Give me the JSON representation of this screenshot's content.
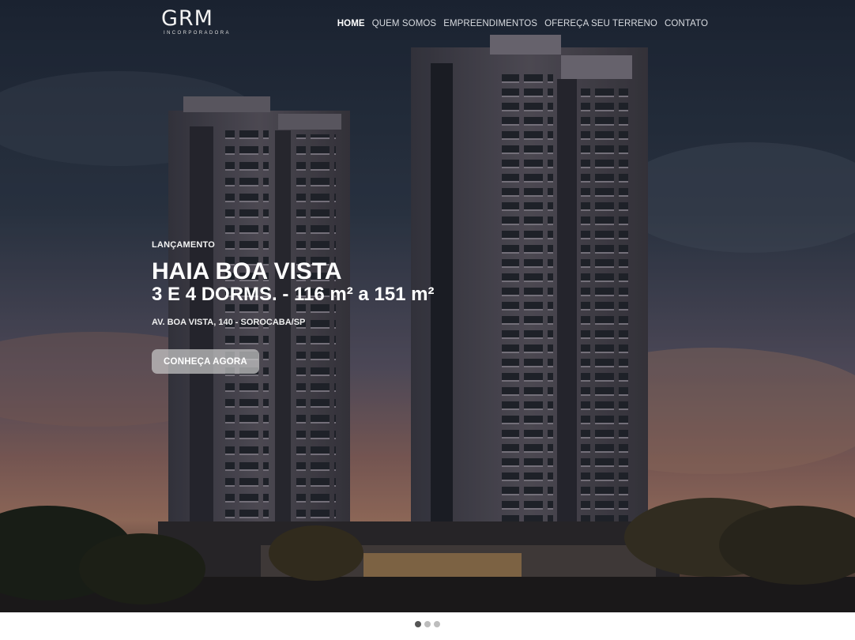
{
  "brand": {
    "name": "GRM",
    "tagline": "INCORPORADORA"
  },
  "nav": {
    "items": [
      {
        "label": "HOME",
        "active": true
      },
      {
        "label": "QUEM SOMOS",
        "active": false
      },
      {
        "label": "EMPREENDIMENTOS",
        "active": false
      },
      {
        "label": "OFEREÇA SEU TERRENO",
        "active": false
      },
      {
        "label": "CONTATO",
        "active": false
      }
    ]
  },
  "hero": {
    "tag": "LANÇAMENTO",
    "title": "HAIA BOA VISTA",
    "subtitle": "3 E 4 DORMS. - 116 m² a 151 m²",
    "address": "AV. BOA VISTA, 140 - SOROCABA/SP",
    "cta_label": "CONHEÇA AGORA"
  },
  "slider": {
    "count": 3,
    "active_index": 0
  },
  "colors": {
    "nav_active": "#ffffff",
    "nav_text": "#d8dbe0",
    "cta_bg": "#c8c8c8",
    "dot_active": "#555555",
    "dot_inactive": "#bdbdbd"
  }
}
